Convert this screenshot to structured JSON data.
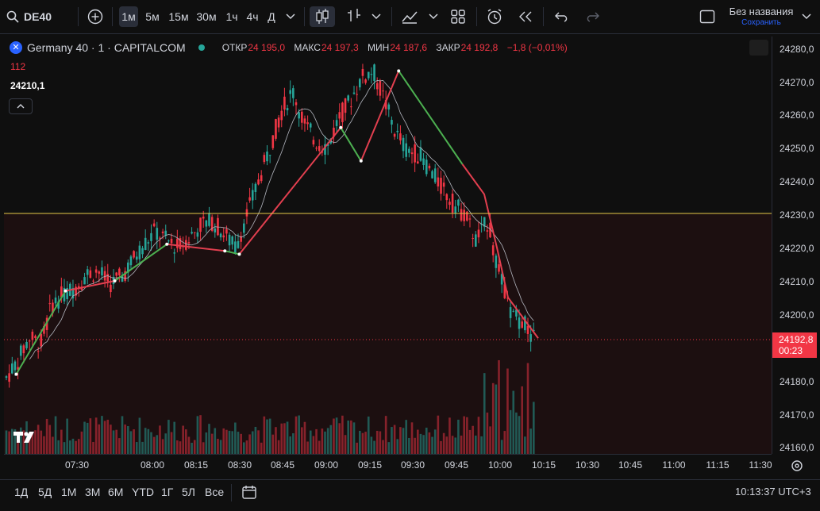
{
  "toolbar": {
    "symbol": "DE40",
    "intervals": [
      "1м",
      "5м",
      "15м",
      "30м",
      "1ч",
      "4ч",
      "Д"
    ],
    "active_interval": "1м",
    "layout_name": "Без названия",
    "save_label": "Сохранить"
  },
  "legend": {
    "title": "Germany 40 · 1 · CAPITALCOM",
    "open_label": "ОТКР",
    "open": "24 195,0",
    "high_label": "МАКС",
    "high": "24 197,3",
    "low_label": "МИН",
    "low": "24 187,6",
    "close_label": "ЗАКР",
    "close": "24 192,8",
    "change": "−1,8 (−0,01%)",
    "volume": "112",
    "indicator_value": "24210,1"
  },
  "price_axis": {
    "ticks": [
      "24280,0",
      "24270,0",
      "24260,0",
      "24250,0",
      "24240,0",
      "24230,0",
      "24220,0",
      "24210,0",
      "24200,0",
      "24180,0",
      "24170,0",
      "24160,0"
    ],
    "last_price": "24192,8",
    "countdown": "00:23"
  },
  "time_axis": {
    "ticks": [
      "07:30",
      "08:00",
      "08:15",
      "08:30",
      "08:45",
      "09:00",
      "09:15",
      "09:30",
      "09:45",
      "10:00",
      "10:15",
      "10:30",
      "10:45",
      "11:00",
      "11:15",
      "11:30"
    ]
  },
  "bottom": {
    "ranges": [
      "1Д",
      "5Д",
      "1М",
      "3М",
      "6М",
      "YTD",
      "1Г",
      "5Л",
      "Все"
    ],
    "clock": "10:13:37 UTC+3"
  },
  "chart_data": {
    "type": "candlestick",
    "symbol": "Germany 40",
    "horizontal_line": 24230,
    "last_price": 24192.8,
    "ylim": [
      24157,
      24282
    ],
    "x_ticks": [
      "07:30",
      "08:00",
      "08:15",
      "08:30",
      "08:45",
      "09:00",
      "09:15",
      "09:30",
      "09:45",
      "10:00",
      "10:15"
    ],
    "close_path": [
      24181,
      24186,
      24193,
      24191,
      24203,
      24206,
      24208,
      24212,
      24213,
      24209,
      24211,
      24216,
      24221,
      24225,
      24222,
      24220,
      24223,
      24227,
      24228,
      24224,
      24220,
      24230,
      24240,
      24250,
      24261,
      24267,
      24257,
      24252,
      24250,
      24259,
      24264,
      24271,
      24273,
      24264,
      24254,
      24249,
      24248,
      24243,
      24238,
      24233,
      24230,
      24222,
      24228,
      24212,
      24200,
      24198,
      24192.8
    ],
    "zigzag": [
      {
        "t": "07:13",
        "p": 24182,
        "dir": "up"
      },
      {
        "t": "07:30",
        "p": 24207,
        "dir": "down"
      },
      {
        "t": "07:47",
        "p": 24210,
        "dir": "up"
      },
      {
        "t": "08:05",
        "p": 24221,
        "dir": "down"
      },
      {
        "t": "08:25",
        "p": 24219,
        "dir": "up"
      },
      {
        "t": "08:30",
        "p": 24218,
        "dir": "down"
      },
      {
        "t": "09:05",
        "p": 24256,
        "dir": "up"
      },
      {
        "t": "09:12",
        "p": 24246,
        "dir": "down"
      },
      {
        "t": "09:25",
        "p": 24273,
        "dir": "up"
      },
      {
        "t": "09:47",
        "p": 24245,
        "dir": "down"
      }
    ]
  }
}
